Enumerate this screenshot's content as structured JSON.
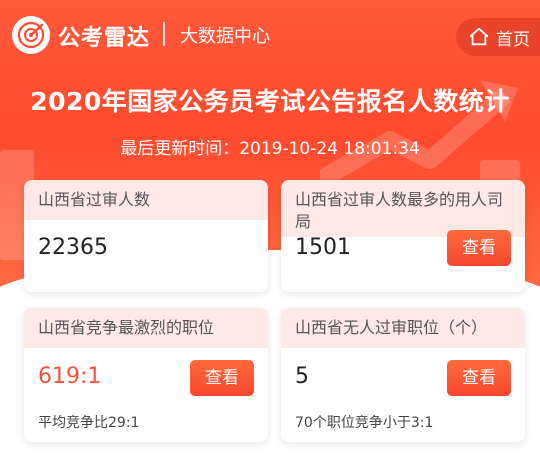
{
  "header": {
    "logo_text": "公考雷达",
    "subtitle": "大数据中心",
    "home_label": "首页"
  },
  "title": "2020年国家公务员考试公告报名人数统计",
  "update_time": "最后更新时间：2019-10-24 18:01:34",
  "cards": [
    {
      "label": "山西省过审人数",
      "value": "22365"
    },
    {
      "label": "山西省过审人数最多的用人司局",
      "value": "1501",
      "button": "查看"
    },
    {
      "label": "山西省竞争最激烈的职位",
      "value": "619:1",
      "button": "查看",
      "note": "平均竞争比29:1"
    },
    {
      "label": "山西省无人过审职位（个）",
      "value": "5",
      "button": "查看",
      "note": "70个职位竞争小于3:1"
    }
  ],
  "colors": {
    "brand": "#ff4a2e",
    "card_header": "#ffe8e6",
    "highlight": "#f0533a"
  }
}
